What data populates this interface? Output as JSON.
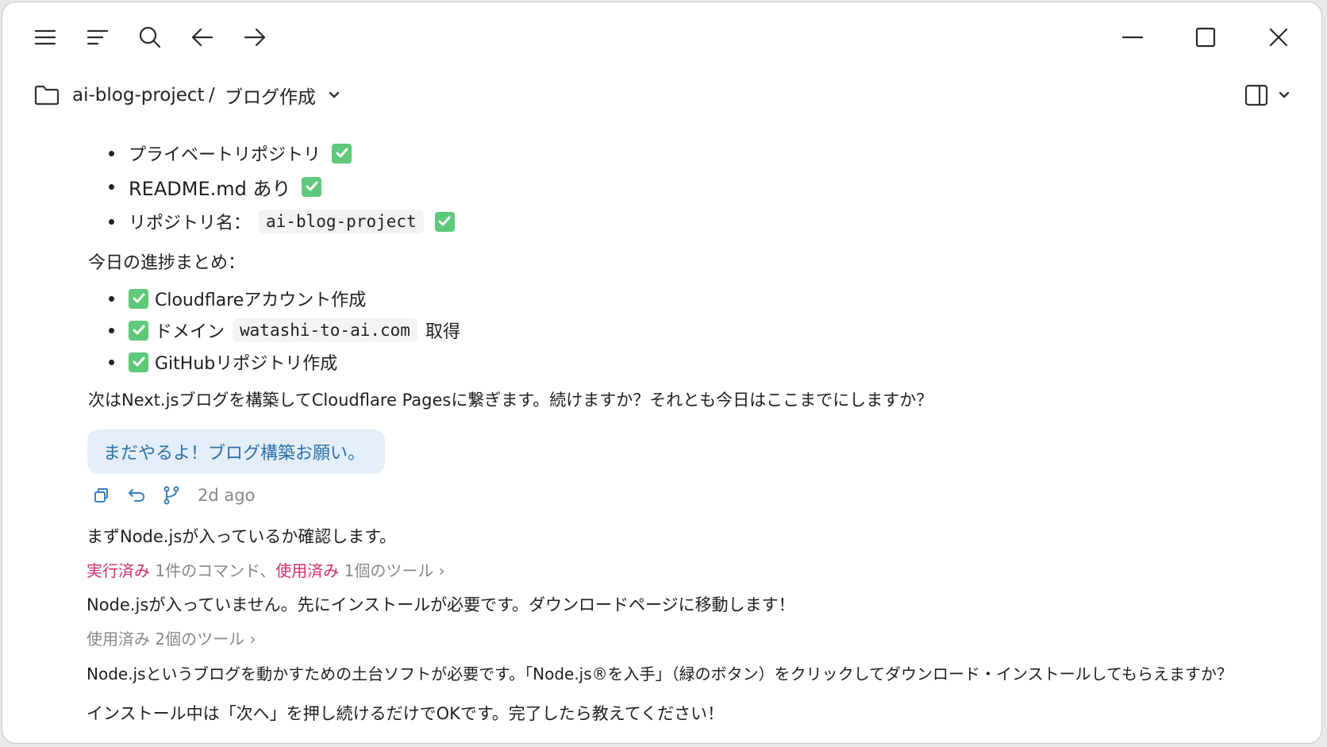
{
  "breadcrumb": {
    "project": "ai-blog-project",
    "separator": "/",
    "page": "ブログ作成"
  },
  "repo_checklist": [
    {
      "text": "プライベートリポジトリ"
    },
    {
      "text": "README.md あり"
    },
    {
      "text": "リポジトリ名：",
      "code": "ai-blog-project"
    }
  ],
  "progress_heading": "今日の進捗まとめ：",
  "progress_items": [
    {
      "text": "Cloudflareアカウント作成"
    },
    {
      "text_before": "ドメイン",
      "code": "watashi-to-ai.com",
      "text_after": "取得"
    },
    {
      "text": "GitHubリポジトリ作成"
    }
  ],
  "question": "次はNext.jsブログを構築してCloudflare Pagesに繋ぎます。続けますか？それとも今日はここまでにしますか？",
  "user_message": "まだやるよ！ブログ構築お願い。",
  "message_time": "2d ago",
  "assistant": {
    "line1": "まずNode.jsが入っているか確認します。",
    "tools1": {
      "executed_label": "実行済み",
      "executed_count": "1件のコマンド、",
      "used_label": "使用済み",
      "used_count": "1個のツール",
      "chevron": "›"
    },
    "line2": "Node.jsが入っていません。先にインストールが必要です。ダウンロードページに移動します！",
    "tools2": {
      "text": "使用済み 2個のツール",
      "chevron": "›"
    },
    "line3": "Node.jsというブログを動かすための土台ソフトが必要です。「Node.js®を入手」（緑のボタン）をクリックしてダウンロード・インストールしてもらえますか？",
    "line4": "インストール中は「次へ」を押し続けるだけでOKです。完了したら教えてください！"
  },
  "colors": {
    "check_green": "#5ec97a",
    "accent_blue": "#3a7fc0",
    "bubble_bg": "#e3eef8",
    "pink_label": "#d12f6e"
  }
}
